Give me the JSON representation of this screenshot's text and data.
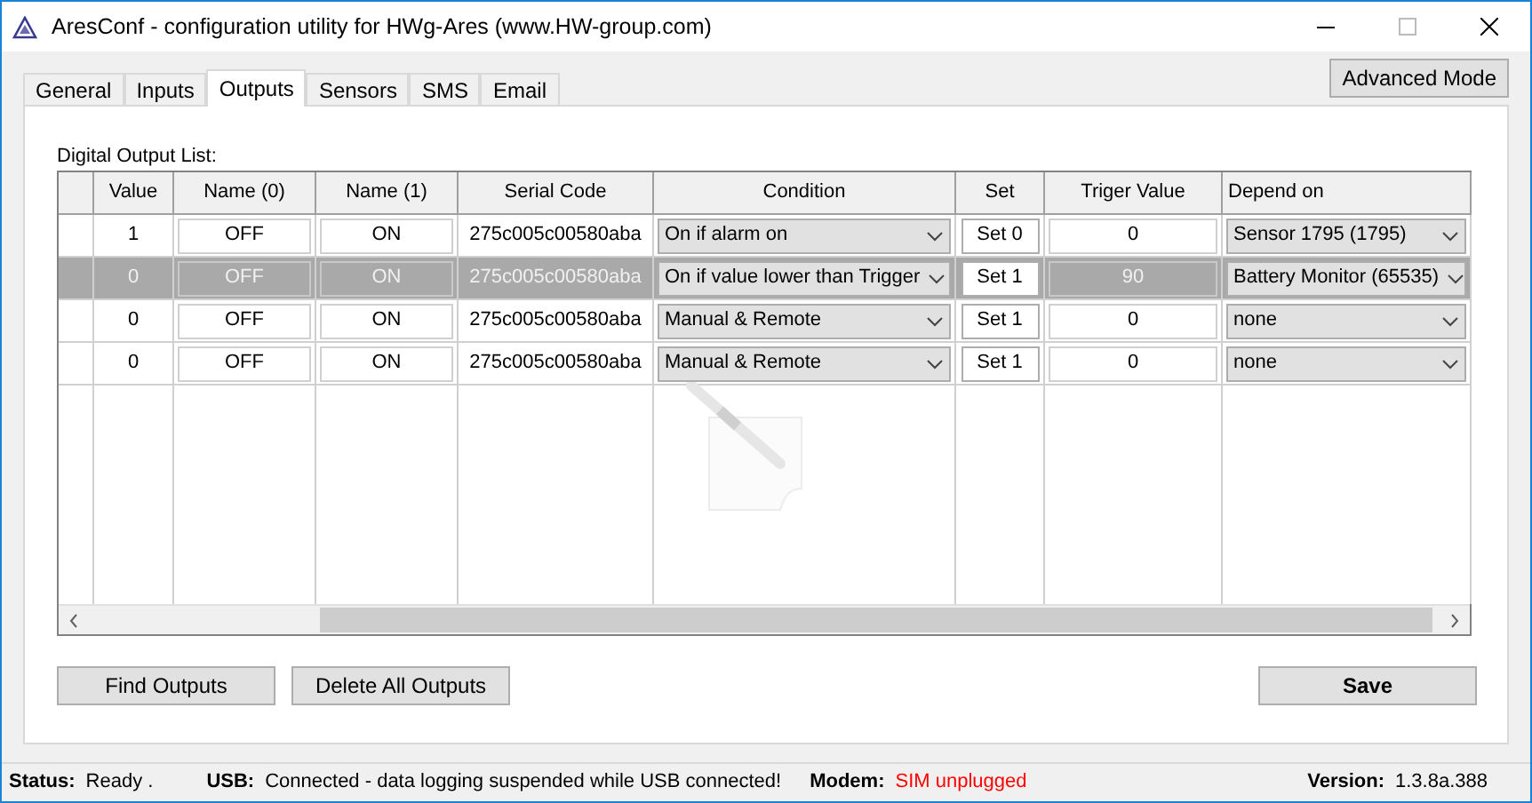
{
  "window": {
    "title": "AresConf - configuration utility for HWg-Ares (www.HW-group.com)"
  },
  "tabs": [
    {
      "label": "General",
      "selected": false
    },
    {
      "label": "Inputs",
      "selected": false
    },
    {
      "label": "Outputs",
      "selected": true
    },
    {
      "label": "Sensors",
      "selected": false
    },
    {
      "label": "SMS",
      "selected": false
    },
    {
      "label": "Email",
      "selected": false
    }
  ],
  "advanced_button": "Advanced Mode",
  "list_label": "Digital Output List:",
  "table": {
    "columns": [
      "Value",
      "Name (0)",
      "Name (1)",
      "Serial Code",
      "Condition",
      "Set",
      "Triger Value",
      "Depend on"
    ],
    "rows": [
      {
        "selected": false,
        "value": "1",
        "name_0": "OFF",
        "name_1": "ON",
        "serial": "275c005c00580aba",
        "condition": "On if alarm on",
        "set": "Set 0",
        "trigger": "0",
        "depend_on": "Sensor 1795 (1795)"
      },
      {
        "selected": true,
        "value": "0",
        "name_0": "OFF",
        "name_1": "ON",
        "serial": "275c005c00580aba",
        "condition": "On if value lower than Trigger",
        "set": "Set 1",
        "trigger": "90",
        "depend_on": "Battery Monitor (65535)"
      },
      {
        "selected": false,
        "value": "0",
        "name_0": "OFF",
        "name_1": "ON",
        "serial": "275c005c00580aba",
        "condition": "Manual & Remote",
        "set": "Set 1",
        "trigger": "0",
        "depend_on": "none"
      },
      {
        "selected": false,
        "value": "0",
        "name_0": "OFF",
        "name_1": "ON",
        "serial": "275c005c00580aba",
        "condition": "Manual & Remote",
        "set": "Set 1",
        "trigger": "0",
        "depend_on": "none"
      }
    ]
  },
  "buttons": [
    "Find Outputs",
    "Delete All Outputs"
  ],
  "save_button": "Save",
  "status_bar": [
    {
      "label": "Status:",
      "value": "Ready .",
      "color": "#000000"
    },
    {
      "label": "USB:",
      "value": "Connected - data logging suspended while USB connected!",
      "color": "#000000"
    },
    {
      "label": "Modem:",
      "value": "SIM unplugged",
      "color": "#ff0000"
    },
    {
      "label": "Version:",
      "value": "1.3.8a.388",
      "color": "#000000"
    }
  ]
}
